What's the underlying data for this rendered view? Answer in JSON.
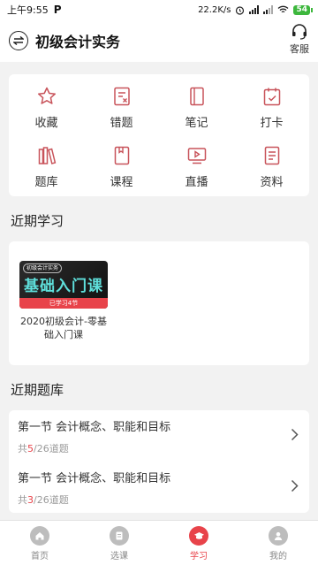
{
  "status": {
    "time": "上午9:55",
    "app_indicator": "P",
    "speed": "22.2K/s",
    "battery": "54"
  },
  "header": {
    "title": "初级会计实务",
    "service_label": "客服"
  },
  "grid": [
    {
      "label": "收藏",
      "icon": "star-icon"
    },
    {
      "label": "错题",
      "icon": "wrong-question-icon"
    },
    {
      "label": "笔记",
      "icon": "notebook-icon"
    },
    {
      "label": "打卡",
      "icon": "checkin-icon"
    },
    {
      "label": "题库",
      "icon": "books-icon"
    },
    {
      "label": "课程",
      "icon": "course-icon"
    },
    {
      "label": "直播",
      "icon": "live-icon"
    },
    {
      "label": "资料",
      "icon": "document-icon"
    }
  ],
  "recent": {
    "title": "近期学习",
    "course": {
      "tag": "初级会计实务",
      "cover_text": "基础入门课",
      "progress": "已学习4节",
      "name": "2020初级会计-零基础入门课"
    }
  },
  "bank": {
    "title": "近期题库",
    "items": [
      {
        "title": "第一节 会计概念、职能和目标",
        "prefix": "共",
        "done": "5",
        "total": "/26道题"
      },
      {
        "title": "第一节 会计概念、职能和目标",
        "prefix": "共",
        "done": "3",
        "total": "/26道题"
      }
    ]
  },
  "tabs": [
    {
      "label": "首页",
      "icon": "home-icon",
      "active": false
    },
    {
      "label": "选课",
      "icon": "course-select-icon",
      "active": false
    },
    {
      "label": "学习",
      "icon": "study-icon",
      "active": true
    },
    {
      "label": "我的",
      "icon": "profile-icon",
      "active": false
    }
  ],
  "colors": {
    "accent": "#e8434a",
    "icon_stroke": "#c8535a",
    "background": "#f2f2f2"
  }
}
